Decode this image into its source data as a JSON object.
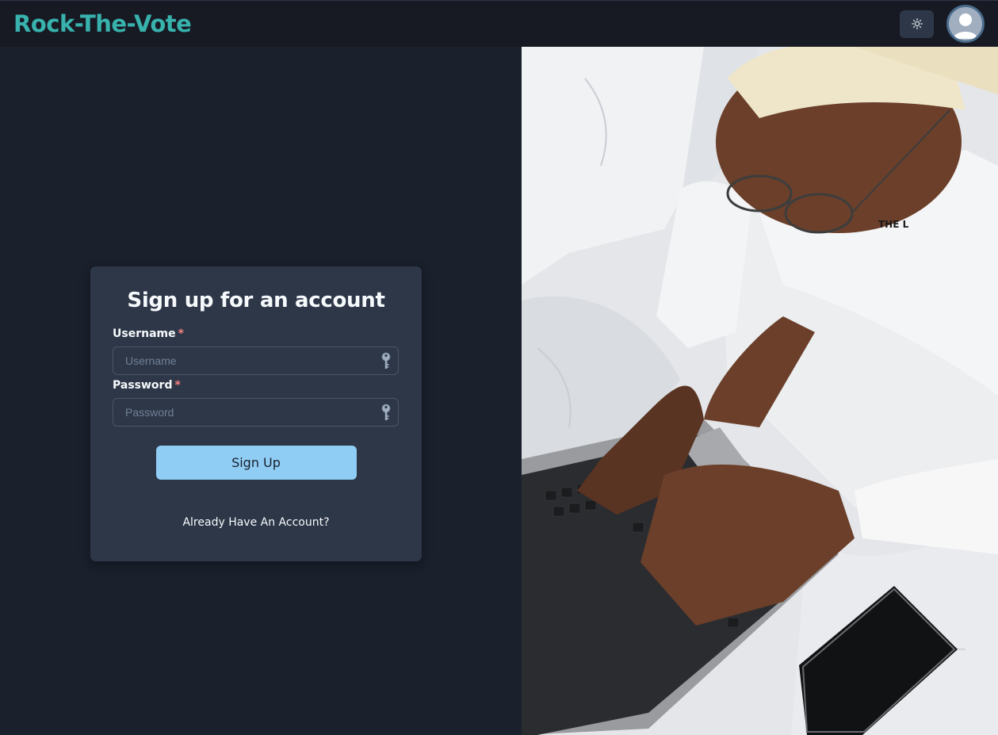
{
  "navbar": {
    "brand": "Rock-The-Vote",
    "theme_toggle_icon": "sun-icon",
    "avatar_icon": "user-avatar-icon"
  },
  "signup": {
    "title": "Sign up for an account",
    "username": {
      "label": "Username",
      "required_mark": "*",
      "placeholder": "Username",
      "icon": "key-icon"
    },
    "password": {
      "label": "Password",
      "required_mark": "*",
      "placeholder": "Password",
      "icon": "key-icon"
    },
    "submit_label": "Sign Up",
    "switch_link": "Already Have An Account?"
  },
  "hero_image": {
    "printed_text": "THE L"
  },
  "colors": {
    "brand": "#38b2ac",
    "background": "#1a202c",
    "navbar": "#171923",
    "card": "#2d3748",
    "button": "#90cdf4",
    "required": "#fc8181"
  }
}
